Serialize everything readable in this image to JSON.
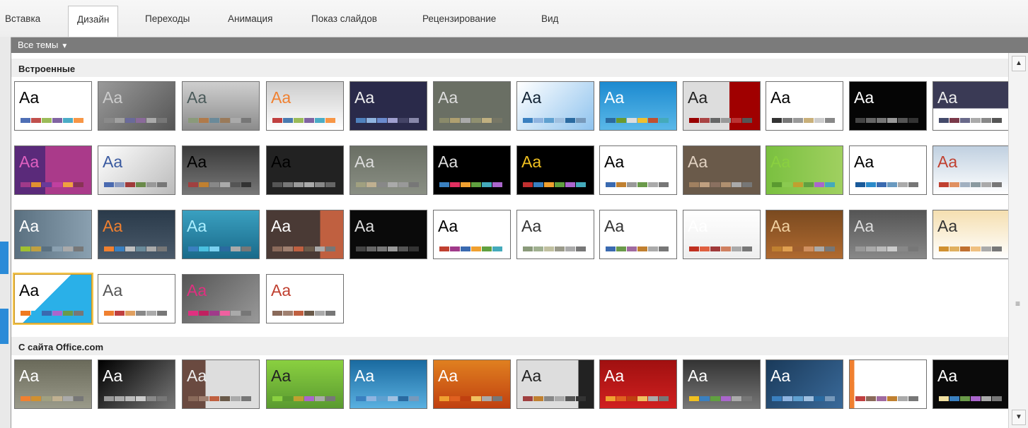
{
  "ribbon": {
    "tabs": [
      "Вставка",
      "Дизайн",
      "Переходы",
      "Анимация",
      "Показ слайдов",
      "Рецензирование",
      "Вид"
    ],
    "active_tab": "Дизайн"
  },
  "gallery": {
    "filter_label": "Все темы",
    "filter_arrow": "▼",
    "sections": {
      "builtin": {
        "title": "Встроенные"
      },
      "office": {
        "title": "С сайта Office.com"
      }
    },
    "thumb_text": "Aa",
    "selected_theme_index": 36
  },
  "scrollbar": {
    "up_icon": "▲",
    "down_icon": "▼",
    "grip_icon": "≡"
  },
  "colors": {
    "filter_bar": "#7b7b7b",
    "selected_border": "#f2c34a",
    "section_header_bg": "#efefef"
  }
}
